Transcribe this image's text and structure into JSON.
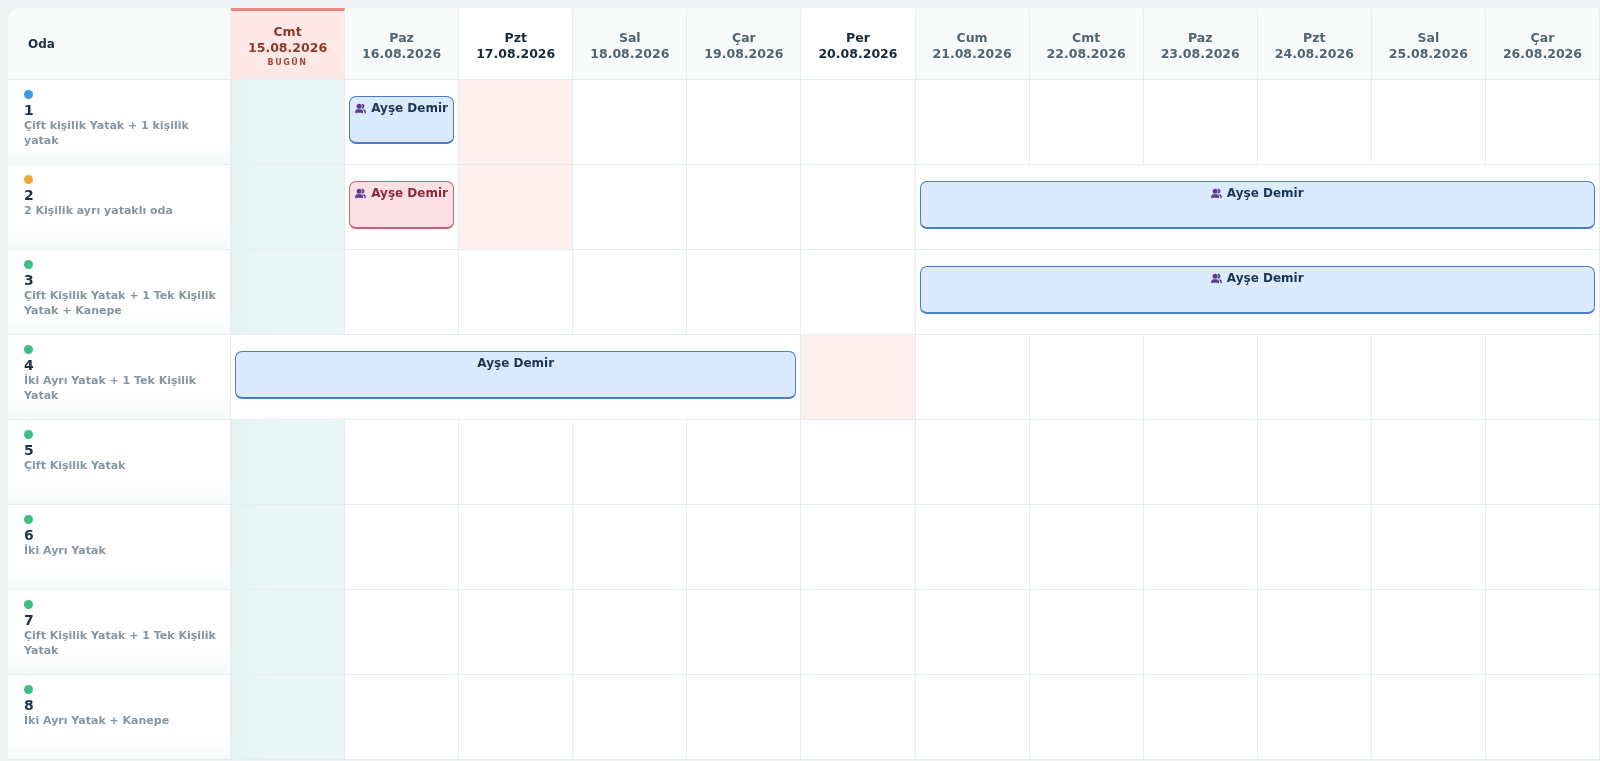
{
  "room_header": "Oda",
  "days": [
    {
      "weekday": "Cmt",
      "date": "15.08.2026",
      "kind": "today",
      "badge": "BUGÜN"
    },
    {
      "weekday": "Paz",
      "date": "16.08.2026",
      "kind": "normal"
    },
    {
      "weekday": "Pzt",
      "date": "17.08.2026",
      "kind": "highlight"
    },
    {
      "weekday": "Sal",
      "date": "18.08.2026",
      "kind": "normal"
    },
    {
      "weekday": "Çar",
      "date": "19.08.2026",
      "kind": "normal"
    },
    {
      "weekday": "Per",
      "date": "20.08.2026",
      "kind": "highlight"
    },
    {
      "weekday": "Cum",
      "date": "21.08.2026",
      "kind": "normal"
    },
    {
      "weekday": "Cmt",
      "date": "22.08.2026",
      "kind": "normal"
    },
    {
      "weekday": "Paz",
      "date": "23.08.2026",
      "kind": "normal"
    },
    {
      "weekday": "Pzt",
      "date": "24.08.2026",
      "kind": "normal"
    },
    {
      "weekday": "Sal",
      "date": "25.08.2026",
      "kind": "normal"
    },
    {
      "weekday": "Çar",
      "date": "26.08.2026",
      "kind": "normal"
    }
  ],
  "rooms": [
    {
      "number": "1",
      "description": "Çift kişilik Yatak + 1 kişilik yatak",
      "color": "#3b9ae1",
      "cells": [
        {
          "kind": "empty"
        },
        {
          "kind": "booking",
          "guest": "Ayşe Demir",
          "color": "#dbeafe",
          "group": true
        },
        {
          "kind": "checkout"
        },
        {
          "kind": "empty"
        },
        {
          "kind": "empty"
        },
        {
          "kind": "empty"
        },
        {
          "kind": "empty"
        },
        {
          "kind": "empty"
        },
        {
          "kind": "empty"
        },
        {
          "kind": "empty"
        },
        {
          "kind": "empty"
        },
        {
          "kind": "empty"
        }
      ]
    },
    {
      "number": "2",
      "description": "2 Kişilik ayrı yataklı oda",
      "color": "#e8a838",
      "cells": [
        {
          "kind": "empty"
        },
        {
          "kind": "booking",
          "guest": "Ayşe Demir",
          "color": "#fde0e6",
          "group": true
        },
        {
          "kind": "checkout"
        },
        {
          "kind": "empty"
        },
        {
          "kind": "empty"
        },
        {
          "kind": "empty"
        },
        {
          "kind": "booking",
          "guest": "Ayşe Demir",
          "color": "#dbeafe",
          "group": true
        },
        {
          "kind": "continued"
        },
        {
          "kind": "continued"
        },
        {
          "kind": "continued"
        },
        {
          "kind": "continued"
        },
        {
          "kind": "continued"
        }
      ]
    },
    {
      "number": "3",
      "description": "Çift Kişilik Yatak + 1 Tek Kişilik Yatak + Kanepe",
      "color": "#3cbf85",
      "cells": [
        {
          "kind": "empty"
        },
        {
          "kind": "empty"
        },
        {
          "kind": "empty"
        },
        {
          "kind": "empty"
        },
        {
          "kind": "empty"
        },
        {
          "kind": "empty"
        },
        {
          "kind": "booking",
          "guest": "Ayşe Demir",
          "color": "#dbeafe",
          "group": true
        },
        {
          "kind": "continued"
        },
        {
          "kind": "continued"
        },
        {
          "kind": "continued"
        },
        {
          "kind": "continued"
        },
        {
          "kind": "continued"
        }
      ]
    },
    {
      "number": "4",
      "description": "İki Ayrı Yatak + 1 Tek Kişilik Yatak",
      "color": "#3cbf85",
      "cells": [
        {
          "kind": "booking",
          "guest": "Ayşe Demir",
          "color": "#dbeafe",
          "group": false
        },
        {
          "kind": "continued"
        },
        {
          "kind": "continued"
        },
        {
          "kind": "continued"
        },
        {
          "kind": "continued"
        },
        {
          "kind": "checkout"
        },
        {
          "kind": "empty"
        },
        {
          "kind": "empty"
        },
        {
          "kind": "empty"
        },
        {
          "kind": "empty"
        },
        {
          "kind": "empty"
        },
        {
          "kind": "empty"
        }
      ]
    },
    {
      "number": "5",
      "description": "Çift Kişilik Yatak",
      "color": "#3cbf85",
      "cells": [
        {
          "kind": "empty"
        },
        {
          "kind": "empty"
        },
        {
          "kind": "empty"
        },
        {
          "kind": "empty"
        },
        {
          "kind": "empty"
        },
        {
          "kind": "empty"
        },
        {
          "kind": "empty"
        },
        {
          "kind": "empty"
        },
        {
          "kind": "empty"
        },
        {
          "kind": "empty"
        },
        {
          "kind": "empty"
        },
        {
          "kind": "empty"
        }
      ]
    },
    {
      "number": "6",
      "description": "İki Ayrı Yatak",
      "color": "#3cbf85",
      "cells": [
        {
          "kind": "empty"
        },
        {
          "kind": "empty"
        },
        {
          "kind": "empty"
        },
        {
          "kind": "empty"
        },
        {
          "kind": "empty"
        },
        {
          "kind": "empty"
        },
        {
          "kind": "empty"
        },
        {
          "kind": "empty"
        },
        {
          "kind": "empty"
        },
        {
          "kind": "empty"
        },
        {
          "kind": "empty"
        },
        {
          "kind": "empty"
        }
      ]
    },
    {
      "number": "7",
      "description": "Çift Kişilik Yatak + 1 Tek Kişilik Yatak",
      "color": "#3cbf85",
      "cells": [
        {
          "kind": "empty"
        },
        {
          "kind": "empty"
        },
        {
          "kind": "empty"
        },
        {
          "kind": "empty"
        },
        {
          "kind": "empty"
        },
        {
          "kind": "empty"
        },
        {
          "kind": "empty"
        },
        {
          "kind": "empty"
        },
        {
          "kind": "empty"
        },
        {
          "kind": "empty"
        },
        {
          "kind": "empty"
        },
        {
          "kind": "empty"
        }
      ]
    },
    {
      "number": "8",
      "description": "İki Ayrı Yatak + Kanepe",
      "color": "#3cbf85",
      "cells": [
        {
          "kind": "empty"
        },
        {
          "kind": "empty"
        },
        {
          "kind": "empty"
        },
        {
          "kind": "empty"
        },
        {
          "kind": "empty"
        },
        {
          "kind": "empty"
        },
        {
          "kind": "empty"
        },
        {
          "kind": "empty"
        },
        {
          "kind": "empty"
        },
        {
          "kind": "empty"
        },
        {
          "kind": "empty"
        },
        {
          "kind": "empty"
        }
      ]
    }
  ]
}
